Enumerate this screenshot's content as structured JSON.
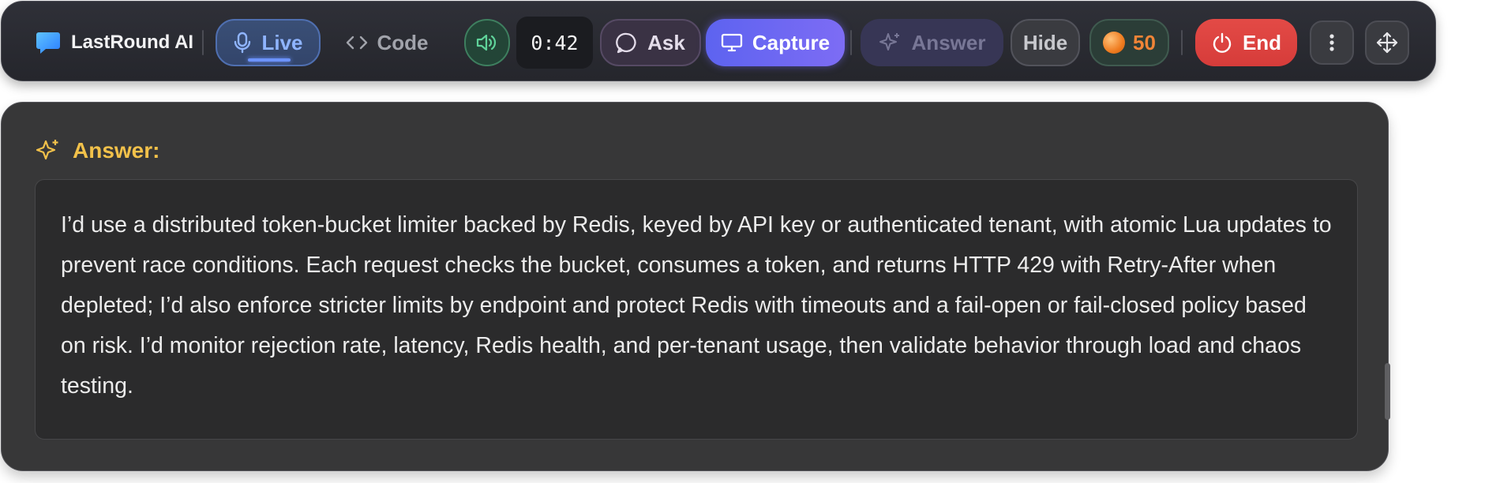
{
  "toolbar": {
    "app_name": "LastRound AI",
    "live_label": "Live",
    "code_label": "Code",
    "timer": "0:42",
    "ask_label": "Ask",
    "capture_label": "Capture",
    "answer_label": "Answer",
    "hide_label": "Hide",
    "coins": "50",
    "end_label": "End"
  },
  "panel": {
    "heading": "Answer:",
    "answer_text": "I’d use a distributed token-bucket limiter backed by Redis, keyed by API key or authenticated tenant, with atomic Lua updates to prevent race conditions. Each request checks the bucket, consumes a token, and returns HTTP 429 with Retry-After when depleted; I’d also enforce stricter limits by endpoint and protect Redis with timeouts and a fail-open or fail-closed policy based on risk. I’d monitor rejection rate, latency, Redis health, and per-tenant usage, then validate behavior through load and chaos testing."
  },
  "icons": [
    "chat-bubble-icon",
    "microphone-icon",
    "code-icon",
    "speaker-icon",
    "message-circle-icon",
    "monitor-icon",
    "sparkles-icon",
    "coin-icon",
    "power-icon",
    "more-vertical-icon",
    "move-icon"
  ],
  "colors": {
    "accent_blue": "#8fb4ff",
    "capture_purple": "#6d67f2",
    "end_red": "#dd4340",
    "answer_heading": "#f2c14a",
    "coins_orange": "#f08437"
  }
}
